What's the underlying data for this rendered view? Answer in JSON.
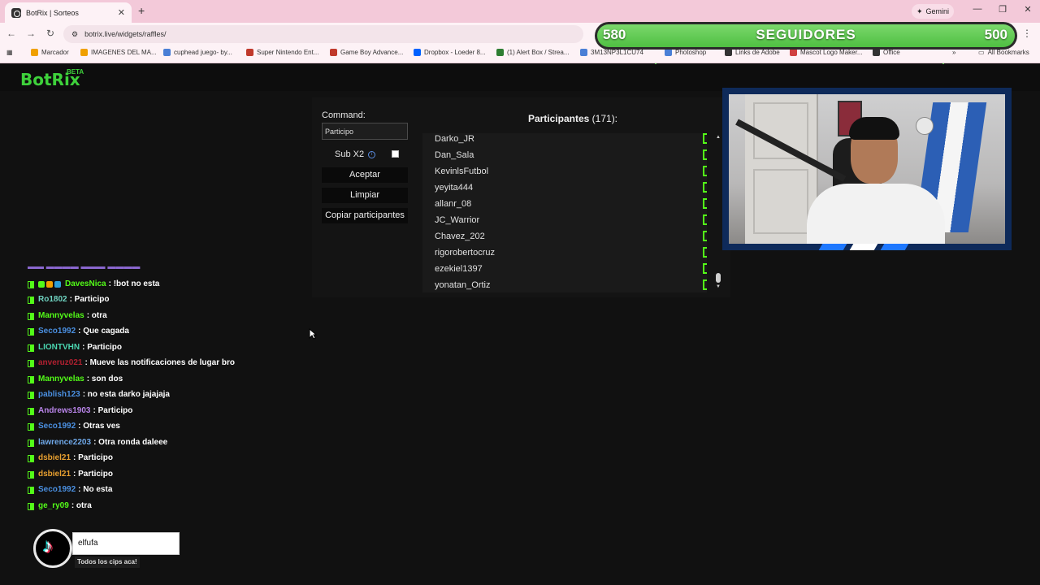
{
  "browser": {
    "tab_title": "BotRix | Sorteos",
    "tab_close": "✕",
    "new_tab": "+",
    "gemini": "Gemini",
    "url": "botrix.live/widgets/raffles/",
    "bookmarks": [
      {
        "label": "Marcador",
        "color": "#f0a000"
      },
      {
        "label": "IMAGENES DEL MA...",
        "color": "#f0a000"
      },
      {
        "label": "cuphead juego- by...",
        "color": "#4a7fd6"
      },
      {
        "label": "Super Nintendo Ent...",
        "color": "#c0392b"
      },
      {
        "label": "Game Boy Advance...",
        "color": "#c0392b"
      },
      {
        "label": "Dropbox - Loeder 8...",
        "color": "#0061ff"
      },
      {
        "label": "(1) Alert Box / Strea...",
        "color": "#2e7d32"
      },
      {
        "label": "3M13NP3L1CU74",
        "color": "#4a7fd6"
      },
      {
        "label": "Photoshop",
        "color": "#4a7fd6"
      },
      {
        "label": "Links de Adobe",
        "color": "#333333"
      },
      {
        "label": "Mascot Logo Maker...",
        "color": "#d04040"
      },
      {
        "label": "Office",
        "color": "#333333"
      }
    ],
    "all_bookmarks": "All Bookmarks"
  },
  "followers": {
    "current": "580",
    "label": "SEGUIDORES",
    "goal": "500"
  },
  "site": {
    "logo": "BotRix",
    "beta": "BETA"
  },
  "raffle": {
    "command_label": "Command:",
    "command_value": "Participo",
    "sub_label": "Sub X2",
    "accept": "Aceptar",
    "clear": "Limpiar",
    "copy": "Copiar participantes",
    "participants_label": "Participantes",
    "participants_count": "(171):",
    "participants": [
      "Darko_JR",
      "Dan_Sala",
      "KevinlsFutbol",
      "yeyita444",
      "allanr_08",
      "JC_Warrior",
      "Chavez_202",
      "rigorobertocruz",
      "ezekiel1397",
      "yonatan_Ortiz"
    ]
  },
  "chat": {
    "messages": [
      {
        "user": "DavesNica",
        "text": ": !bot no esta",
        "color": "#53fc18",
        "badges": true
      },
      {
        "user": "Ro1802",
        "text": ": Participo",
        "color": "#6fd3c0",
        "badges": false
      },
      {
        "user": "Mannyvelas",
        "text": ": otra",
        "color": "#53fc18",
        "badges": false
      },
      {
        "user": "Seco1992",
        "text": ": Que cagada",
        "color": "#4a8fe0",
        "badges": false
      },
      {
        "user": "LIONTVHN",
        "text": ": Participo",
        "color": "#4ad6b0",
        "badges": false
      },
      {
        "user": "anveruz021",
        "text": ": Mueve las notificaciones de lugar bro",
        "color": "#b02030",
        "badges": false
      },
      {
        "user": "Mannyvelas",
        "text": ": son dos",
        "color": "#53fc18",
        "badges": false
      },
      {
        "user": "pablish123",
        "text": ": no esta darko jajajaja",
        "color": "#4a8fe0",
        "badges": false
      },
      {
        "user": "Andrews1903",
        "text": ": Participo",
        "color": "#b884e8",
        "badges": false
      },
      {
        "user": "Seco1992",
        "text": ": Otras ves",
        "color": "#4a8fe0",
        "badges": false
      },
      {
        "user": "lawrence2203",
        "text": ": Otra ronda daleee",
        "color": "#6fa8e8",
        "badges": false
      },
      {
        "user": "dsbiel21",
        "text": ": Participo",
        "color": "#e8a030",
        "badges": false
      },
      {
        "user": "dsbiel21",
        "text": ": Participo",
        "color": "#e8a030",
        "badges": false
      },
      {
        "user": "Seco1992",
        "text": ": No esta",
        "color": "#4a8fe0",
        "badges": false
      },
      {
        "user": "ge_ry09",
        "text": ": otra",
        "color": "#53fc18",
        "badges": false
      }
    ]
  },
  "tiktok": {
    "user": "elfufa",
    "subtitle": "Todos los cips aca!"
  }
}
